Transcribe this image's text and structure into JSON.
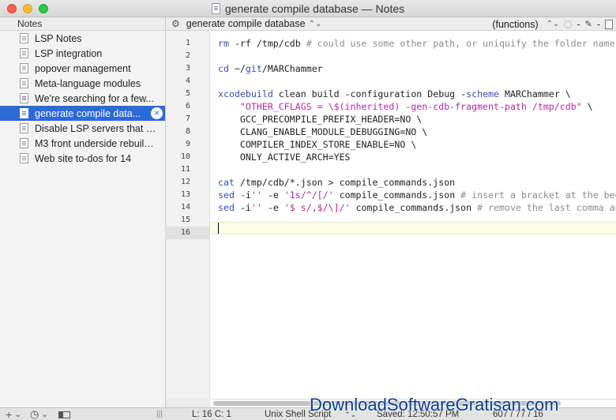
{
  "window": {
    "title": "generate compile database — Notes"
  },
  "sidebar": {
    "header": "Notes",
    "items": [
      {
        "label": "LSP Notes",
        "icon": "document-icon",
        "marked": false
      },
      {
        "label": "LSP integration",
        "icon": "document-icon",
        "marked": false
      },
      {
        "label": "popover management",
        "icon": "document-icon",
        "marked": false
      },
      {
        "label": "Meta-language modules",
        "icon": "document-icon",
        "marked": false
      },
      {
        "label": "We're searching for a few...",
        "icon": "document-icon",
        "marked": true
      },
      {
        "label": "generate compile data...",
        "icon": "document-icon",
        "marked": true,
        "selected": true
      },
      {
        "label": "Disable LSP servers that cr...",
        "icon": "document-icon",
        "marked": false
      },
      {
        "label": "M3 front underside rebuild...",
        "icon": "document-icon",
        "marked": false
      },
      {
        "label": "Web site to-dos for 14",
        "icon": "document-icon",
        "marked": false
      }
    ],
    "close_glyph": "×"
  },
  "toolbar": {
    "gear": "⚙",
    "doc_title": "generate compile database",
    "updown": "⌃⌄",
    "functions": "(functions)",
    "minus": "-",
    "pin": "✎"
  },
  "editor": {
    "line_numbers": [
      "1",
      "2",
      "3",
      "4",
      "5",
      "6",
      "7",
      "8",
      "9",
      "10",
      "11",
      "12",
      "13",
      "14",
      "15",
      "16"
    ],
    "current_line": 16
  },
  "statusbar": {
    "add": "+",
    "add_caret": "⌄",
    "clock": "◷",
    "clock_caret": "⌄",
    "drag": "|||",
    "position": "L: 16 C: 1",
    "language": "Unix Shell Script",
    "language_caret": "⌃⌄",
    "saved": "Saved: 12:50:57 PM",
    "stats": "607 / 77 / 16"
  },
  "watermark": "DownloadSoftwareGratisan.com",
  "colors": {
    "selection": "#2b6bd8",
    "keyword": "#3b4fb8",
    "comment": "#8d8d8d",
    "string": "#b02e9a",
    "current_line": "#fbfce4"
  }
}
